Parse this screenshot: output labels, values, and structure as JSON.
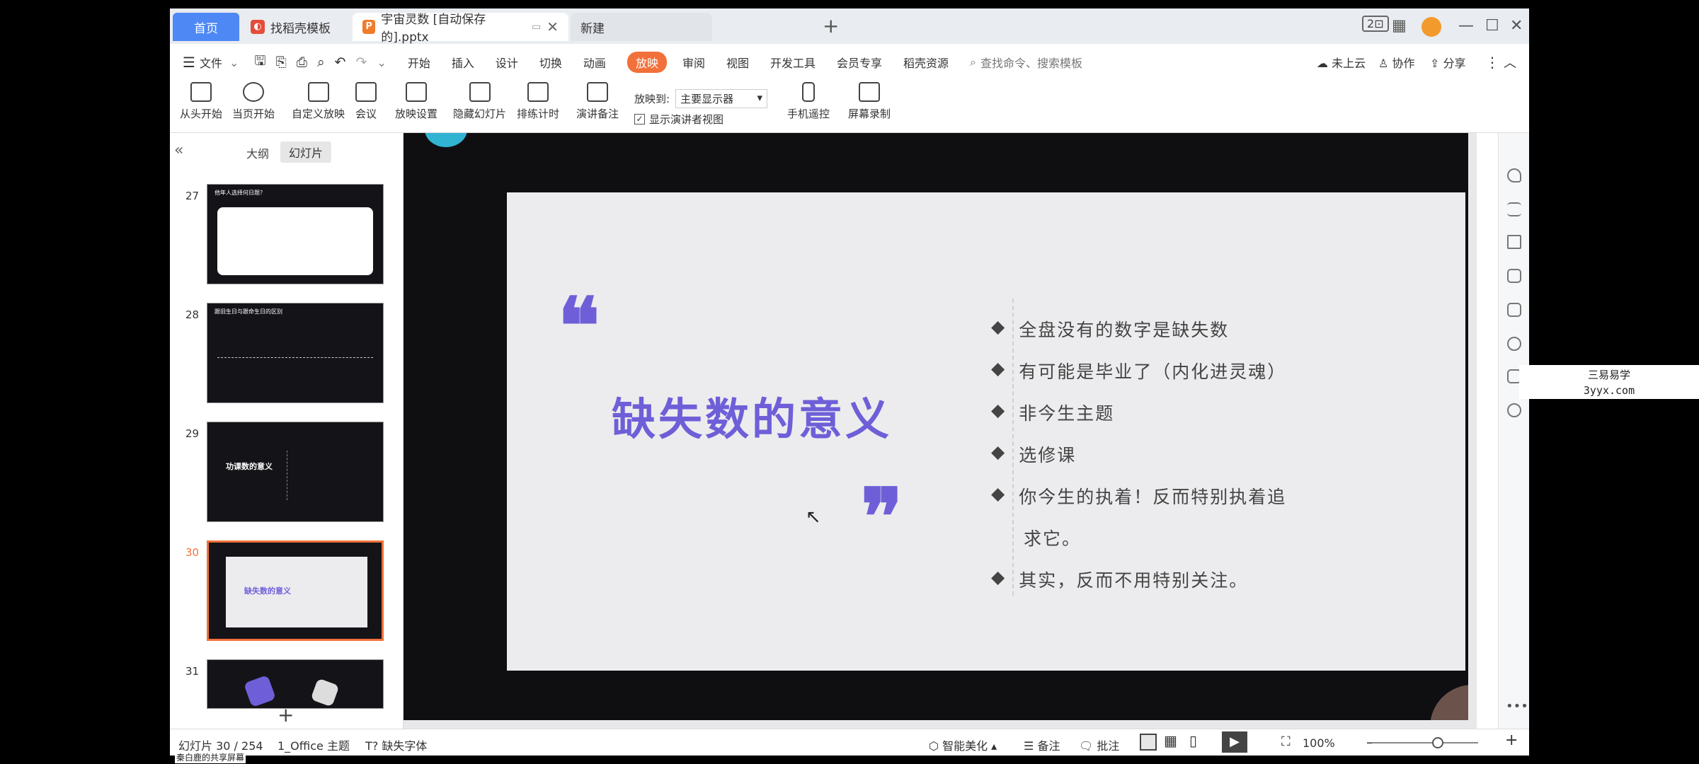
{
  "tabs": {
    "home": "首页",
    "template": "找稻壳模板",
    "doc": "宇宙灵数 [自动保存的].pptx",
    "new": "新建",
    "add": "+"
  },
  "window_controls": {
    "badge": "2"
  },
  "menu": {
    "file": "文件",
    "items": [
      "开始",
      "插入",
      "设计",
      "切换",
      "动画",
      "放映",
      "审阅",
      "视图",
      "开发工具",
      "会员专享",
      "稻壳资源"
    ],
    "active": "放映",
    "search_placeholder": "查找命令、搜索模板",
    "cloud": "未上云",
    "collab": "协作",
    "share": "分享"
  },
  "ribbon": {
    "from_start": "从头开始",
    "from_current": "当页开始",
    "custom": "自定义放映",
    "meeting": "会议",
    "settings": "放映设置",
    "hide": "隐藏幻灯片",
    "rehearse": "排练计时",
    "notes": "演讲备注",
    "play_to_label": "放映到:",
    "play_to_value": "主要显示器",
    "presenter_view": "显示演讲者视图",
    "phone": "手机遥控",
    "record": "屏幕录制"
  },
  "panel": {
    "outline": "大纲",
    "slides": "幻灯片",
    "collapse": "«",
    "add": "+",
    "thumbnails": [
      {
        "num": "27",
        "title": "他年人选择何日题？"
      },
      {
        "num": "28",
        "title": "跟旧生日与跟命生日的区别"
      },
      {
        "num": "29",
        "title": "功课数的意义"
      },
      {
        "num": "30",
        "title": "缺失数的意义"
      },
      {
        "num": "31",
        "title": ""
      }
    ],
    "selected": "30"
  },
  "slide": {
    "title": "缺失数的意义",
    "bullets": [
      "全盘没有的数字是缺失数",
      "有可能是毕业了（内化进灵魂）",
      "非今生主题",
      "选修课",
      "你今生的执着！反而特别执着追",
      "求它。",
      "其实，反而不用特别关注。"
    ],
    "bullet_symbol": "◆"
  },
  "status": {
    "slide_info": "幻灯片 30 / 254",
    "theme": "1_Office 主题",
    "missing_font": "缺失字体",
    "beautify": "智能美化",
    "notes": "备注",
    "comment": "批注",
    "zoom": "100%",
    "zoom_level": 0.62
  },
  "watermark": {
    "line1": "三易易学",
    "line2": "3yyx.com"
  },
  "share_label": "秦白鹿的共享屏幕",
  "colors": {
    "accent": "#6e5fd8",
    "brand": "#f2703a",
    "home_tab": "#4e88f5"
  }
}
